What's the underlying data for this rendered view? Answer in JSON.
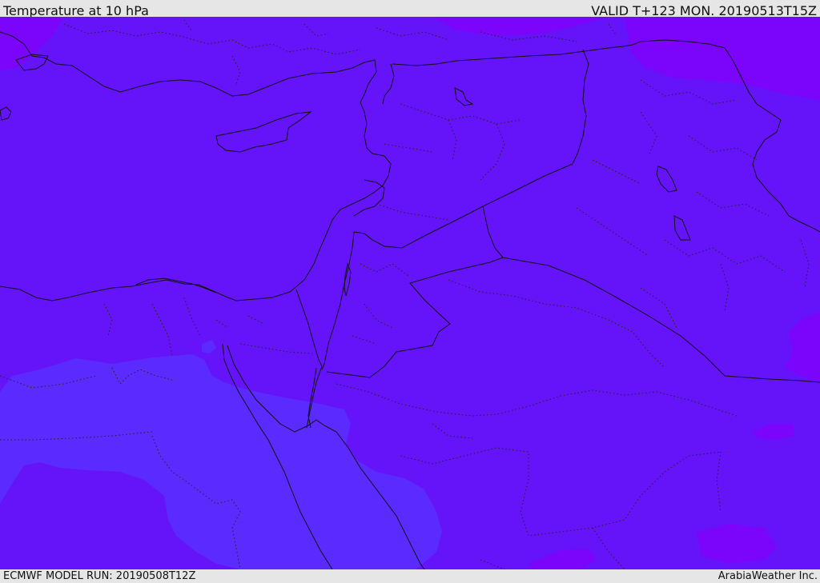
{
  "header": {
    "title": "Temperature at 10 hPa",
    "valid": "VALID T+123 MON. 20190513T15Z"
  },
  "footer": {
    "model_run": "ECMWF MODEL RUN: 20190508T12Z",
    "brand": "ArabiaWeather Inc."
  },
  "colors": {
    "base_fill": "#6514fa",
    "warm_fill": "#7a05fa",
    "cool_fill": "#5a2aff",
    "boundary": "#111111"
  }
}
